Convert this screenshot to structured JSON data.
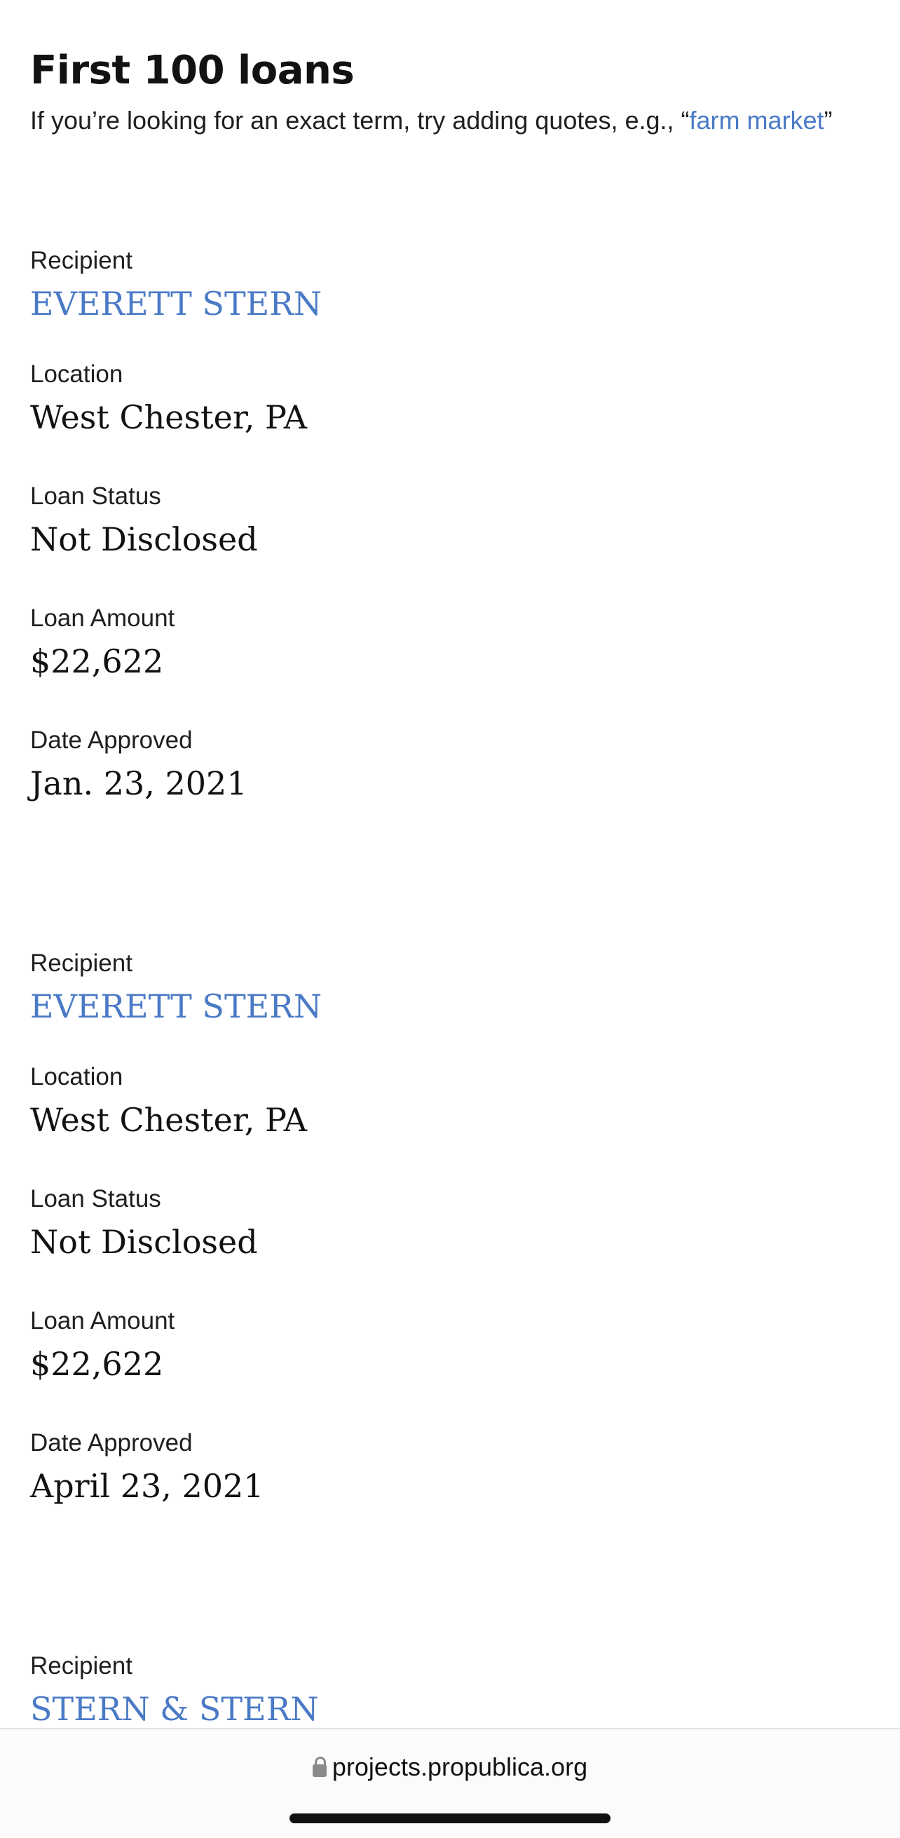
{
  "header": {
    "title": "First 100 loans",
    "hint_prefix": "If you’re looking for an exact term, try adding quotes, e.g., “",
    "hint_link": "farm market",
    "hint_suffix": "”"
  },
  "labels": {
    "recipient": "Recipient",
    "location": "Location",
    "loan_status": "Loan Status",
    "loan_amount": "Loan Amount",
    "date_approved": "Date Approved"
  },
  "loans": [
    {
      "recipient": "EVERETT STERN",
      "location": "West Chester, PA",
      "loan_status": "Not Disclosed",
      "loan_amount": "$22,622",
      "date_approved": "Jan. 23, 2021"
    },
    {
      "recipient": "EVERETT STERN",
      "location": "West Chester, PA",
      "loan_status": "Not Disclosed",
      "loan_amount": "$22,622",
      "date_approved": "April 23, 2021"
    },
    {
      "recipient": "STERN & STERN"
    }
  ],
  "browser": {
    "url": "projects.propublica.org"
  },
  "colors": {
    "link": "#4a7ac6",
    "text": "#121212"
  }
}
